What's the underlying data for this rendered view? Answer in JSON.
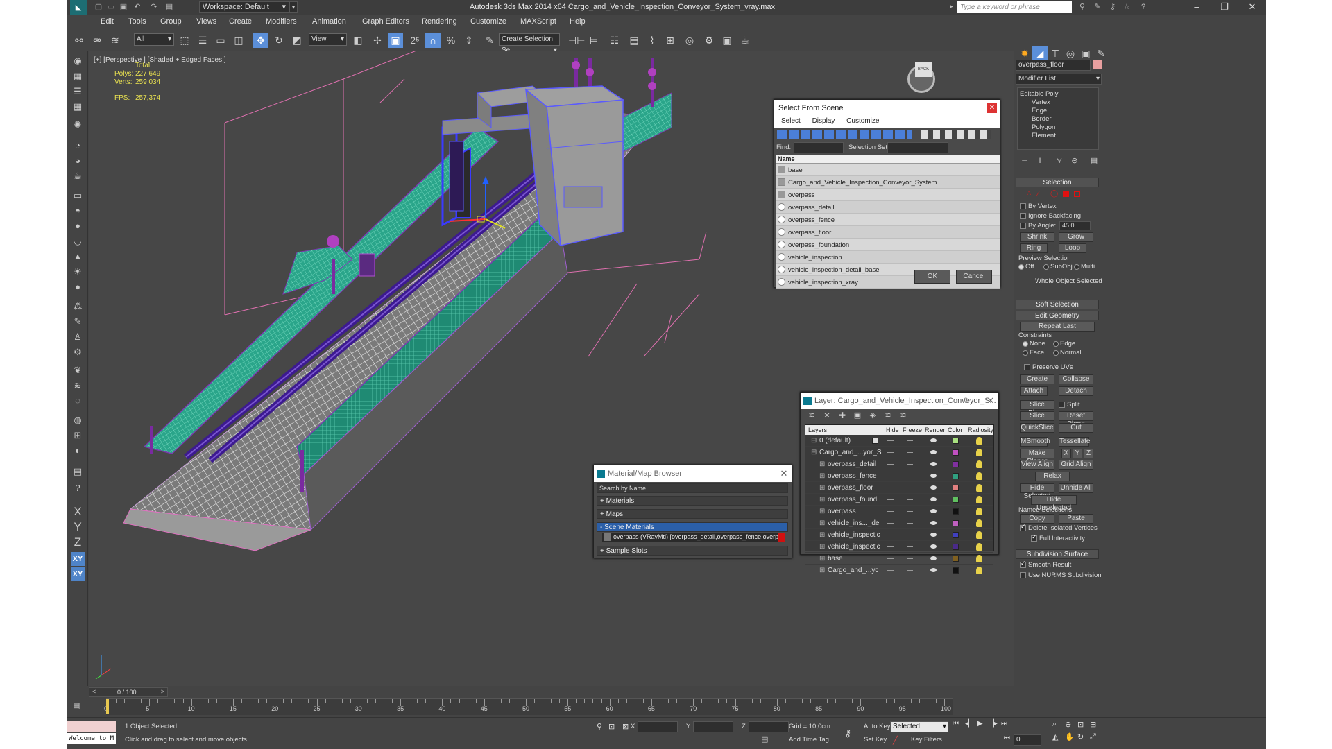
{
  "titlebar": {
    "workspace": "Workspace: Default",
    "app_title": "Autodesk 3ds Max  2014 x64     Cargo_and_Vehicle_Inspection_Conveyor_System_vray.max",
    "search_placeholder": "Type a keyword or phrase"
  },
  "menu": [
    "Edit",
    "Tools",
    "Group",
    "Views",
    "Create",
    "Modifiers",
    "Animation",
    "Graph Editors",
    "Rendering",
    "Customize",
    "MAXScript",
    "Help"
  ],
  "toolbar": {
    "filter": "All",
    "ref_coord": "View",
    "named_sel": "Create Selection Se"
  },
  "viewport": {
    "label": "[+] [Perspective ] [Shaded + Edged Faces ]",
    "stats": {
      "total": "Total",
      "polys_label": "Polys:",
      "polys": "227 649",
      "verts_label": "Verts:",
      "verts": "259 034",
      "fps_label": "FPS:",
      "fps": "257,374"
    },
    "viewcube": "BACK"
  },
  "select_from_scene": {
    "title": "Select From Scene",
    "tabs": [
      "Select",
      "Display",
      "Customize"
    ],
    "find_label": "Find:",
    "selset_label": "Selection Set:",
    "column": "Name",
    "objects": [
      "base",
      "Cargo_and_Vehicle_Inspection_Conveyor_System",
      "overpass",
      "overpass_detail",
      "overpass_fence",
      "overpass_floor",
      "overpass_foundation",
      "vehicle_inspection",
      "vehicle_inspection_detail_base",
      "vehicle_inspection_xray"
    ],
    "ok": "OK",
    "cancel": "Cancel"
  },
  "layer_dialog": {
    "title": "Layer: Cargo_and_Vehicle_Inspection_Conveyor_S...",
    "help": "?",
    "columns": [
      "Layers",
      "Hide",
      "Freeze",
      "Render",
      "Color",
      "Radiosity"
    ],
    "rows": [
      {
        "name": "0 (default)",
        "indent": 0,
        "color": "#a8e080"
      },
      {
        "name": "Cargo_and_...yor_S",
        "indent": 0,
        "color": "#c050c0"
      },
      {
        "name": "overpass_detail",
        "indent": 1,
        "color": "#8030a0"
      },
      {
        "name": "overpass_fence",
        "indent": 1,
        "color": "#30a080"
      },
      {
        "name": "overpass_floor",
        "indent": 1,
        "color": "#e08080"
      },
      {
        "name": "overpass_found..",
        "indent": 1,
        "color": "#60c060"
      },
      {
        "name": "overpass",
        "indent": 1,
        "color": "#111111"
      },
      {
        "name": "vehicle_ins..._de",
        "indent": 1,
        "color": "#c060c0"
      },
      {
        "name": "vehicle_inspectic",
        "indent": 1,
        "color": "#4040c0"
      },
      {
        "name": "vehicle_inspectic",
        "indent": 1,
        "color": "#4a2a8a"
      },
      {
        "name": "base",
        "indent": 1,
        "color": "#806020"
      },
      {
        "name": "Cargo_and_...yc",
        "indent": 1,
        "color": "#111111"
      }
    ]
  },
  "material_browser": {
    "title": "Material/Map Browser",
    "search_placeholder": "Search by Name ...",
    "sections": [
      "+ Materials",
      "+ Maps",
      "- Scene Materials"
    ],
    "scene_material": "overpass (VRayMtl) [overpass_detail,overpass_fence,overpa...",
    "sample_slots": "+ Sample Slots"
  },
  "command_panel": {
    "object_name": "overpass_floor",
    "modifier_list": "Modifier List",
    "stack": [
      "Editable Poly",
      "Vertex",
      "Edge",
      "Border",
      "Polygon",
      "Element"
    ],
    "selection": {
      "title": "Selection",
      "by_vertex": "By Vertex",
      "ignore_backfacing": "Ignore Backfacing",
      "by_angle": "By Angle:",
      "angle": "45,0",
      "shrink": "Shrink",
      "grow": "Grow",
      "ring": "Ring",
      "loop": "Loop",
      "preview": "Preview Selection",
      "off": "Off",
      "subobj": "SubObj",
      "multi": "Multi",
      "whole": "Whole Object Selected"
    },
    "soft_selection": "Soft Selection",
    "edit_geometry": {
      "title": "Edit Geometry",
      "repeat_last": "Repeat Last",
      "constraints": "Constraints",
      "none": "None",
      "edge": "Edge",
      "face": "Face",
      "normal": "Normal",
      "preserve_uvs": "Preserve UVs",
      "create": "Create",
      "collapse": "Collapse",
      "attach": "Attach",
      "detach": "Detach",
      "slice_plane": "Slice Plane",
      "split": "Split",
      "slice": "Slice",
      "reset_plane": "Reset Plane",
      "quickslice": "QuickSlice",
      "cut": "Cut",
      "msmooth": "MSmooth",
      "tessellate": "Tessellate",
      "make_planar": "Make Planar",
      "x": "X",
      "y": "Y",
      "z": "Z",
      "view_align": "View Align",
      "grid_align": "Grid Align",
      "relax": "Relax",
      "hide_selected": "Hide Selected",
      "unhide_all": "Unhide All",
      "hide_unselected": "Hide Unselected",
      "named_selections": "Named Selections:",
      "copy": "Copy",
      "paste": "Paste",
      "delete_isolated": "Delete Isolated Vertices",
      "full_interactivity": "Full Interactivity"
    },
    "subdivision": {
      "title": "Subdivision Surface",
      "smooth_result": "Smooth Result",
      "use_nurms": "Use NURMS Subdivision"
    }
  },
  "timeline": {
    "frame": "0 / 100",
    "ticks": [
      "0",
      "5",
      "10",
      "15",
      "20",
      "25",
      "30",
      "35",
      "40",
      "45",
      "50",
      "55",
      "60",
      "65",
      "70",
      "75",
      "80",
      "85",
      "90",
      "95",
      "100"
    ]
  },
  "status": {
    "script_field": "Welcome to M",
    "selected": "1 Object Selected",
    "prompt": "Click and drag to select and move objects",
    "x_label": "X:",
    "y_label": "Y:",
    "z_label": "Z:",
    "grid": "Grid = 10,0cm",
    "add_time_tag": "Add Time Tag",
    "auto_key": "Auto Key",
    "set_key": "Set Key",
    "key_mode": "Selected",
    "key_filters": "Key Filters...",
    "frame_value": "0"
  }
}
